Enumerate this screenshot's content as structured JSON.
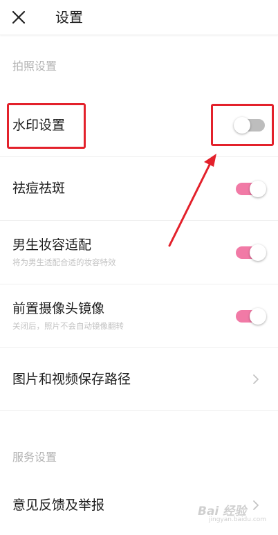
{
  "header": {
    "close_icon": "close-icon",
    "title": "设置"
  },
  "sections": [
    {
      "label": "拍照设置",
      "items": [
        {
          "title": "水印设置",
          "subtitle": "",
          "control": "toggle",
          "on": false
        },
        {
          "title": "祛痘祛斑",
          "subtitle": "",
          "control": "toggle",
          "on": true
        },
        {
          "title": "男生妆容适配",
          "subtitle": "将为男生适配合适的妆容特效",
          "control": "toggle",
          "on": true
        },
        {
          "title": "前置摄像头镜像",
          "subtitle": "关闭后，照片不会自动镜像翻转",
          "control": "toggle",
          "on": true
        },
        {
          "title": "图片和视频保存路径",
          "subtitle": "",
          "control": "chevron-right-icon"
        }
      ]
    },
    {
      "label": "服务设置",
      "items": [
        {
          "title": "意见反馈及举报",
          "subtitle": "",
          "control": "chevron-right-icon"
        }
      ]
    }
  ],
  "watermark": {
    "text": "Bai 经验",
    "subtext": "jingyan.baidu.com"
  },
  "colors": {
    "toggle_on": "#f17aa6",
    "toggle_off": "#bdbdbd",
    "annotation_red": "#e3212b"
  }
}
